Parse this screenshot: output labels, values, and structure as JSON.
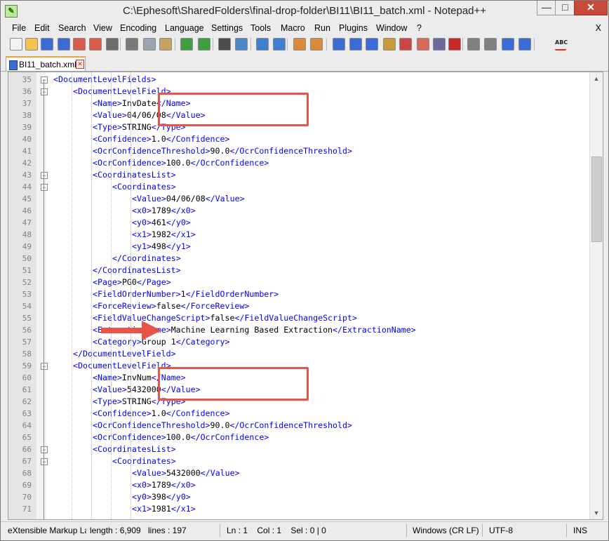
{
  "window": {
    "title": "C:\\Ephesoft\\SharedFolders\\final-drop-folder\\BI11\\BI11_batch.xml - Notepad++"
  },
  "menu": [
    "File",
    "Edit",
    "Search",
    "View",
    "Encoding",
    "Language",
    "Settings",
    "Tools",
    "Macro",
    "Run",
    "Plugins",
    "Window",
    "?"
  ],
  "menu_close": "X",
  "tab": {
    "label": "BI11_batch.xml"
  },
  "toolbar_icons": [
    "new-icon",
    "open-icon",
    "save-icon",
    "save-all-icon",
    "close-icon",
    "close-all-icon",
    "print-icon",
    "cut-icon",
    "copy-icon",
    "paste-icon",
    "undo-icon",
    "redo-icon",
    "find-icon",
    "replace-icon",
    "zoom-in-icon",
    "zoom-out-icon",
    "sync-vertical-icon",
    "sync-horizontal-icon",
    "word-wrap-icon",
    "show-all-chars-icon",
    "indent-guide-icon",
    "doc-map-icon",
    "function-list-icon",
    "folder-workspace-icon",
    "monitoring-icon",
    "record-macro-icon",
    "stop-macro-icon",
    "play-macro-icon",
    "run-macro-multiple-icon",
    "save-macro-icon",
    "spell-check-icon"
  ],
  "lines": [
    {
      "n": "35",
      "fold": "box",
      "indent": 3,
      "parts": [
        {
          "t": "<DocumentLevelFields>",
          "c": "tag"
        }
      ]
    },
    {
      "n": "36",
      "fold": "box",
      "indent": 4,
      "parts": [
        {
          "t": "<DocumentLevelField>",
          "c": "tag"
        }
      ]
    },
    {
      "n": "37",
      "fold": "",
      "indent": 5,
      "parts": [
        {
          "t": "<Name>",
          "c": "tag"
        },
        {
          "t": "InvDate",
          "c": "txt"
        },
        {
          "t": "</Name>",
          "c": "tag"
        }
      ]
    },
    {
      "n": "38",
      "fold": "",
      "indent": 5,
      "parts": [
        {
          "t": "<Value>",
          "c": "tag"
        },
        {
          "t": "04/06/08",
          "c": "txt"
        },
        {
          "t": "</Value>",
          "c": "tag"
        }
      ]
    },
    {
      "n": "39",
      "fold": "",
      "indent": 5,
      "parts": [
        {
          "t": "<Type>",
          "c": "tag"
        },
        {
          "t": "STRING",
          "c": "txt"
        },
        {
          "t": "</Type>",
          "c": "tag"
        }
      ]
    },
    {
      "n": "40",
      "fold": "",
      "indent": 5,
      "parts": [
        {
          "t": "<Confidence>",
          "c": "tag"
        },
        {
          "t": "1.0",
          "c": "txt"
        },
        {
          "t": "</Confidence>",
          "c": "tag"
        }
      ]
    },
    {
      "n": "41",
      "fold": "",
      "indent": 5,
      "parts": [
        {
          "t": "<OcrConfidenceThreshold>",
          "c": "tag"
        },
        {
          "t": "90.0",
          "c": "txt"
        },
        {
          "t": "</OcrConfidenceThreshold>",
          "c": "tag"
        }
      ]
    },
    {
      "n": "42",
      "fold": "",
      "indent": 5,
      "parts": [
        {
          "t": "<OcrConfidence>",
          "c": "tag"
        },
        {
          "t": "100.0",
          "c": "txt"
        },
        {
          "t": "</OcrConfidence>",
          "c": "tag"
        }
      ]
    },
    {
      "n": "43",
      "fold": "box",
      "indent": 5,
      "parts": [
        {
          "t": "<CoordinatesList>",
          "c": "tag"
        }
      ]
    },
    {
      "n": "44",
      "fold": "box",
      "indent": 6,
      "parts": [
        {
          "t": "<Coordinates>",
          "c": "tag"
        }
      ]
    },
    {
      "n": "45",
      "fold": "",
      "indent": 7,
      "parts": [
        {
          "t": "<Value>",
          "c": "tag"
        },
        {
          "t": "04/06/08",
          "c": "txt"
        },
        {
          "t": "</Value>",
          "c": "tag"
        }
      ]
    },
    {
      "n": "46",
      "fold": "",
      "indent": 7,
      "parts": [
        {
          "t": "<x0>",
          "c": "tag"
        },
        {
          "t": "1789",
          "c": "txt"
        },
        {
          "t": "</x0>",
          "c": "tag"
        }
      ]
    },
    {
      "n": "47",
      "fold": "",
      "indent": 7,
      "parts": [
        {
          "t": "<y0>",
          "c": "tag"
        },
        {
          "t": "461",
          "c": "txt"
        },
        {
          "t": "</y0>",
          "c": "tag"
        }
      ]
    },
    {
      "n": "48",
      "fold": "",
      "indent": 7,
      "parts": [
        {
          "t": "<x1>",
          "c": "tag"
        },
        {
          "t": "1982",
          "c": "txt"
        },
        {
          "t": "</x1>",
          "c": "tag"
        }
      ]
    },
    {
      "n": "49",
      "fold": "",
      "indent": 7,
      "parts": [
        {
          "t": "<y1>",
          "c": "tag"
        },
        {
          "t": "498",
          "c": "txt"
        },
        {
          "t": "</y1>",
          "c": "tag"
        }
      ]
    },
    {
      "n": "50",
      "fold": "",
      "indent": 6,
      "parts": [
        {
          "t": "</Coordinates>",
          "c": "tag"
        }
      ]
    },
    {
      "n": "51",
      "fold": "",
      "indent": 5,
      "parts": [
        {
          "t": "</CoordinatesList>",
          "c": "tag"
        }
      ]
    },
    {
      "n": "52",
      "fold": "",
      "indent": 5,
      "parts": [
        {
          "t": "<Page>",
          "c": "tag"
        },
        {
          "t": "PG0",
          "c": "txt"
        },
        {
          "t": "</Page>",
          "c": "tag"
        }
      ]
    },
    {
      "n": "53",
      "fold": "",
      "indent": 5,
      "parts": [
        {
          "t": "<FieldOrderNumber>",
          "c": "tag"
        },
        {
          "t": "1",
          "c": "txt"
        },
        {
          "t": "</FieldOrderNumber>",
          "c": "tag"
        }
      ]
    },
    {
      "n": "54",
      "fold": "",
      "indent": 5,
      "parts": [
        {
          "t": "<ForceReview>",
          "c": "tag"
        },
        {
          "t": "false",
          "c": "txt"
        },
        {
          "t": "</ForceReview>",
          "c": "tag"
        }
      ]
    },
    {
      "n": "55",
      "fold": "",
      "indent": 5,
      "parts": [
        {
          "t": "<FieldValueChangeScript>",
          "c": "tag"
        },
        {
          "t": "false",
          "c": "txt"
        },
        {
          "t": "</FieldValueChangeScript>",
          "c": "tag"
        }
      ]
    },
    {
      "n": "56",
      "fold": "",
      "indent": 5,
      "parts": [
        {
          "t": "<ExtractionName>",
          "c": "tag"
        },
        {
          "t": "Machine Learning Based Extraction",
          "c": "txt"
        },
        {
          "t": "</ExtractionName>",
          "c": "tag"
        }
      ]
    },
    {
      "n": "57",
      "fold": "",
      "indent": 5,
      "parts": [
        {
          "t": "<Category>",
          "c": "tag"
        },
        {
          "t": "Group 1",
          "c": "txt"
        },
        {
          "t": "</Category>",
          "c": "tag"
        }
      ]
    },
    {
      "n": "58",
      "fold": "",
      "indent": 4,
      "parts": [
        {
          "t": "</DocumentLevelField>",
          "c": "tag"
        }
      ]
    },
    {
      "n": "59",
      "fold": "box",
      "indent": 4,
      "parts": [
        {
          "t": "<DocumentLevelField>",
          "c": "tag"
        }
      ]
    },
    {
      "n": "60",
      "fold": "",
      "indent": 5,
      "parts": [
        {
          "t": "<Name>",
          "c": "tag"
        },
        {
          "t": "InvNum",
          "c": "txt"
        },
        {
          "t": "</Name>",
          "c": "tag"
        }
      ]
    },
    {
      "n": "61",
      "fold": "",
      "indent": 5,
      "parts": [
        {
          "t": "<Value>",
          "c": "tag"
        },
        {
          "t": "5432000",
          "c": "txt"
        },
        {
          "t": "</Value>",
          "c": "tag"
        }
      ]
    },
    {
      "n": "62",
      "fold": "",
      "indent": 5,
      "parts": [
        {
          "t": "<Type>",
          "c": "tag"
        },
        {
          "t": "STRING",
          "c": "txt"
        },
        {
          "t": "</Type>",
          "c": "tag"
        }
      ]
    },
    {
      "n": "63",
      "fold": "",
      "indent": 5,
      "parts": [
        {
          "t": "<Confidence>",
          "c": "tag"
        },
        {
          "t": "1.0",
          "c": "txt"
        },
        {
          "t": "</Confidence>",
          "c": "tag"
        }
      ]
    },
    {
      "n": "64",
      "fold": "",
      "indent": 5,
      "parts": [
        {
          "t": "<OcrConfidenceThreshold>",
          "c": "tag"
        },
        {
          "t": "90.0",
          "c": "txt"
        },
        {
          "t": "</OcrConfidenceThreshold>",
          "c": "tag"
        }
      ]
    },
    {
      "n": "65",
      "fold": "",
      "indent": 5,
      "parts": [
        {
          "t": "<OcrConfidence>",
          "c": "tag"
        },
        {
          "t": "100.0",
          "c": "txt"
        },
        {
          "t": "</OcrConfidence>",
          "c": "tag"
        }
      ]
    },
    {
      "n": "66",
      "fold": "box",
      "indent": 5,
      "parts": [
        {
          "t": "<CoordinatesList>",
          "c": "tag"
        }
      ]
    },
    {
      "n": "67",
      "fold": "box",
      "indent": 6,
      "parts": [
        {
          "t": "<Coordinates>",
          "c": "tag"
        }
      ]
    },
    {
      "n": "68",
      "fold": "",
      "indent": 7,
      "parts": [
        {
          "t": "<Value>",
          "c": "tag"
        },
        {
          "t": "5432000",
          "c": "txt"
        },
        {
          "t": "</Value>",
          "c": "tag"
        }
      ]
    },
    {
      "n": "69",
      "fold": "",
      "indent": 7,
      "parts": [
        {
          "t": "<x0>",
          "c": "tag"
        },
        {
          "t": "1789",
          "c": "txt"
        },
        {
          "t": "</x0>",
          "c": "tag"
        }
      ]
    },
    {
      "n": "70",
      "fold": "",
      "indent": 7,
      "parts": [
        {
          "t": "<y0>",
          "c": "tag"
        },
        {
          "t": "398",
          "c": "txt"
        },
        {
          "t": "</y0>",
          "c": "tag"
        }
      ]
    },
    {
      "n": "71",
      "fold": "",
      "indent": 7,
      "parts": [
        {
          "t": "<x1>",
          "c": "tag"
        },
        {
          "t": "1981",
          "c": "txt"
        },
        {
          "t": "</x1>",
          "c": "tag"
        }
      ]
    }
  ],
  "annotations": {
    "highlight_color": "#e8534a",
    "boxes": [
      {
        "first_line": "37",
        "last_line": "38"
      },
      {
        "first_line": "60",
        "last_line": "61"
      }
    ],
    "arrow_line": "56"
  },
  "status": {
    "language": "eXtensible Markup La",
    "length": "length : 6,909",
    "lines": "lines : 197",
    "position": "Ln : 1    Col : 1    Sel : 0 | 0",
    "eol": "Windows (CR LF)",
    "encoding": "UTF-8",
    "mode": "INS"
  },
  "colors": {
    "tag": "#0000ff",
    "text": "#000000"
  }
}
